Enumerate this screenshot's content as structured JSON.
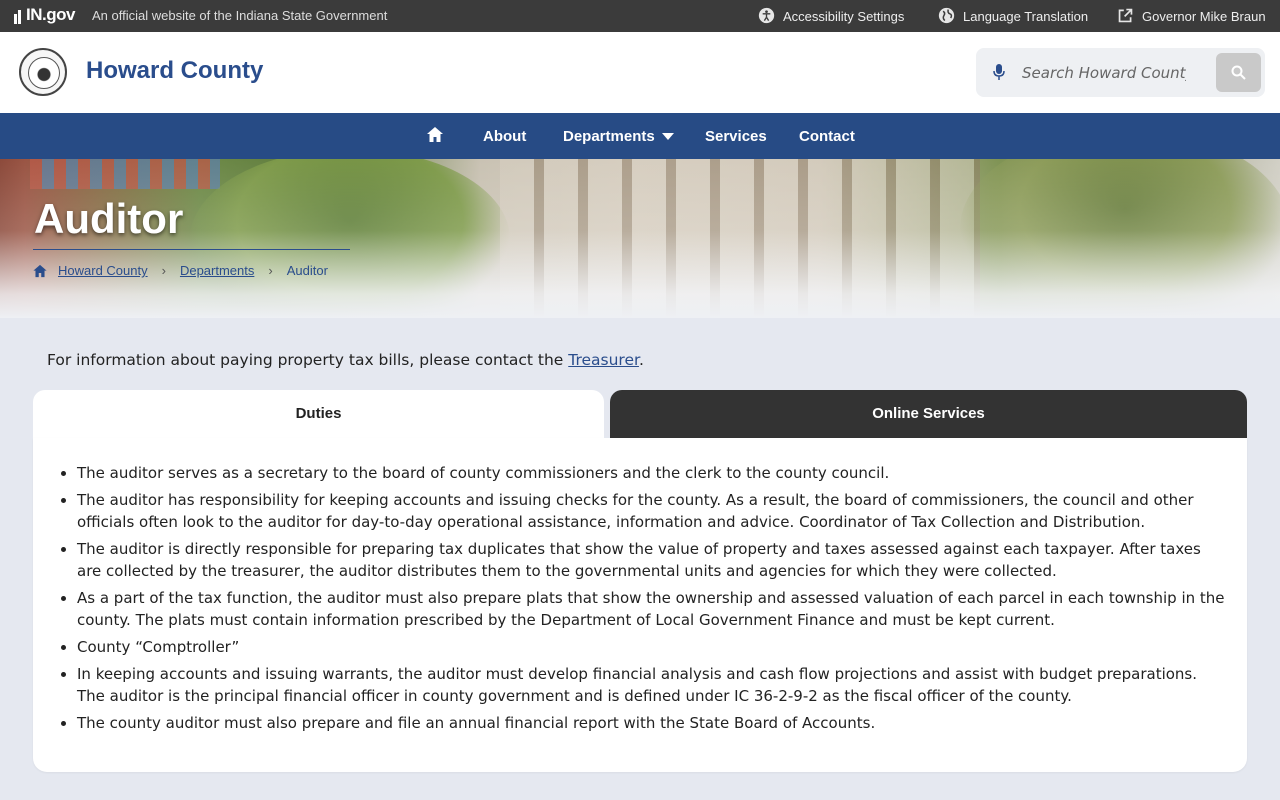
{
  "topbar": {
    "ingov_logo": "IN.gov",
    "official_text": "An official website of the Indiana State Government",
    "links": [
      {
        "label": "Accessibility Settings",
        "icon": "accessibility-icon"
      },
      {
        "label": "Language Translation",
        "icon": "globe-icon"
      },
      {
        "label": "Governor Mike Braun",
        "icon": "external-link-icon"
      }
    ]
  },
  "header": {
    "site_title": "Howard County",
    "search_placeholder": "Search Howard County"
  },
  "nav": {
    "items": [
      "About",
      "Departments",
      "Services",
      "Contact"
    ]
  },
  "hero": {
    "title": "Auditor",
    "breadcrumb": [
      "Howard County",
      "Departments",
      "Auditor"
    ]
  },
  "content": {
    "info_prefix": "For information about paying property tax bills, please contact the ",
    "info_link": "Treasurer",
    "info_suffix": ".",
    "tabs": [
      "Duties",
      "Online Services"
    ],
    "duties": [
      "The auditor serves as a secretary to the board of county commissioners and the clerk to the county council.",
      "The auditor has responsibility for keeping accounts and issuing checks for the county. As a result, the board of commissioners, the council and other officials often look to the auditor for day-to-day operational assistance, information and advice. Coordinator of Tax Collection and Distribution.",
      "The auditor is directly responsible for preparing tax duplicates that show the value of property and taxes assessed against each taxpayer. After taxes are collected by the treasurer, the auditor distributes them to the governmental units and agencies for which they were collected.",
      "As a part of the tax function, the auditor must also prepare plats that show the ownership and assessed valuation of each parcel in each township in the county. The plats must contain information prescribed by the Department of Local Government Finance and must be kept current.",
      "County “Comptroller”",
      "In keeping accounts and issuing warrants, the auditor must develop financial analysis and cash flow projections and assist with budget preparations. The auditor is the principal financial officer in county government and is defined under IC 36-2-9-2 as the fiscal officer of the county.",
      "The county auditor must also prepare and file an annual financial report with the State Board of Accounts."
    ]
  },
  "colors": {
    "brand_blue": "#274b85",
    "title_blue": "#2a4d8c",
    "topbar": "#3b3b3b",
    "active_tab": "#ffffff",
    "inactive_tab": "#333333"
  }
}
